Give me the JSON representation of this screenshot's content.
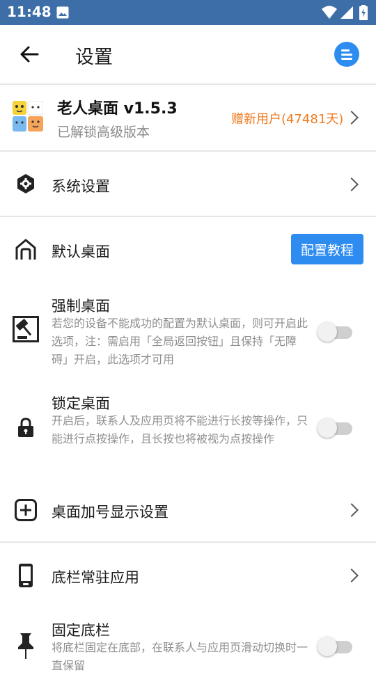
{
  "status_bar": {
    "time": "11:48"
  },
  "toolbar": {
    "title": "设置"
  },
  "app_info": {
    "name": "老人桌面 v1.5.3",
    "subtitle": "已解锁高级版本",
    "gift_label": "赠新用户(47481天)",
    "gift_color": "#f07a20"
  },
  "settings": {
    "system": {
      "label": "系统设置"
    },
    "default_desktop": {
      "label": "默认桌面",
      "button": "配置教程"
    },
    "force_desktop": {
      "label": "强制桌面",
      "desc": "若您的设备不能成功的配置为默认桌面，则可开启此选项，注：需启用「全局返回按钮」且保持「无障碍」开启，此选项才可用",
      "enabled": false
    },
    "lock_desktop": {
      "label": "锁定桌面",
      "desc": "开启后，联系人及应用页将不能进行长按等操作，只能进行点按操作，且长按也将被视为点按操作",
      "enabled": false
    },
    "plus_display": {
      "label": "桌面加号显示设置"
    },
    "dock_apps": {
      "label": "底栏常驻应用"
    },
    "fixed_dock": {
      "label": "固定底栏",
      "desc": "将底栏固定在底部，在联系人与应用页滑动切换时一直保留",
      "enabled": false
    }
  },
  "colors": {
    "status_bar": "#3d6ea8",
    "accent": "#2e8cf0"
  },
  "icons": [
    "image-icon",
    "wifi-icon",
    "signal-icon",
    "battery-icon",
    "back-arrow-icon",
    "menu-icon",
    "gear-hexagon-icon",
    "house-icon",
    "gavel-icon",
    "lock-icon",
    "plus-box-icon",
    "phone-icon",
    "pin-icon"
  ]
}
